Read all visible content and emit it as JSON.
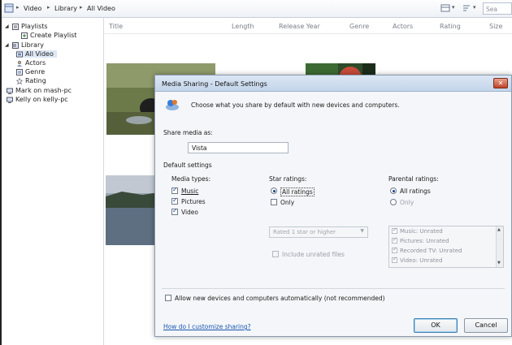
{
  "toolbar": {
    "crumbs": [
      "Video",
      "Library",
      "All Video"
    ],
    "search_placeholder": "Sea"
  },
  "sidebar": {
    "items": [
      {
        "label": "Playlists",
        "level": 0,
        "expander": "▲"
      },
      {
        "label": "Create Playlist",
        "level": 1
      },
      {
        "label": "Library",
        "level": 0,
        "expander": "▲"
      },
      {
        "label": "All Video",
        "level": 1
      },
      {
        "label": "Actors",
        "level": 1
      },
      {
        "label": "Genre",
        "level": 1
      },
      {
        "label": "Rating",
        "level": 1
      },
      {
        "label": "Mark on mash-pc",
        "level": 0
      },
      {
        "label": "Kelly on kelly-pc",
        "level": 0
      }
    ]
  },
  "columns": [
    "Title",
    "Length",
    "Release Year",
    "Genre",
    "Actors",
    "Rating",
    "Size"
  ],
  "dialog": {
    "title": "Media Sharing - Default Settings",
    "intro": "Choose what you share by default with new devices and computers.",
    "share_media_label": "Share media as:",
    "share_media_value": "Vista",
    "default_settings_label": "Default settings",
    "media_types": {
      "label": "Media types:",
      "items": [
        {
          "label": "Music",
          "checked": true
        },
        {
          "label": "Pictures",
          "checked": true
        },
        {
          "label": "Video",
          "checked": true
        }
      ]
    },
    "star_ratings": {
      "label": "Star ratings:",
      "all_label": "All ratings",
      "only_label": "Only",
      "selected": "all",
      "select_value": "Rated 1 star or higher",
      "include_unrated_label": "Include unrated files"
    },
    "parental_ratings": {
      "label": "Parental ratings:",
      "all_label": "All ratings",
      "only_label": "Only",
      "selected": "all",
      "list": [
        "Music: Unrated",
        "Pictures: Unrated",
        "Recorded TV: Unrated",
        "Video: Unrated"
      ]
    },
    "allow_new_label": "Allow new devices and computers automatically (not recommended)",
    "help_link": "How do I customize sharing?",
    "ok_label": "OK",
    "cancel_label": "Cancel"
  },
  "colors": {
    "accent": "#1a56b0",
    "title_bar": "#c4d5ea",
    "close_button": "#c0422a"
  }
}
